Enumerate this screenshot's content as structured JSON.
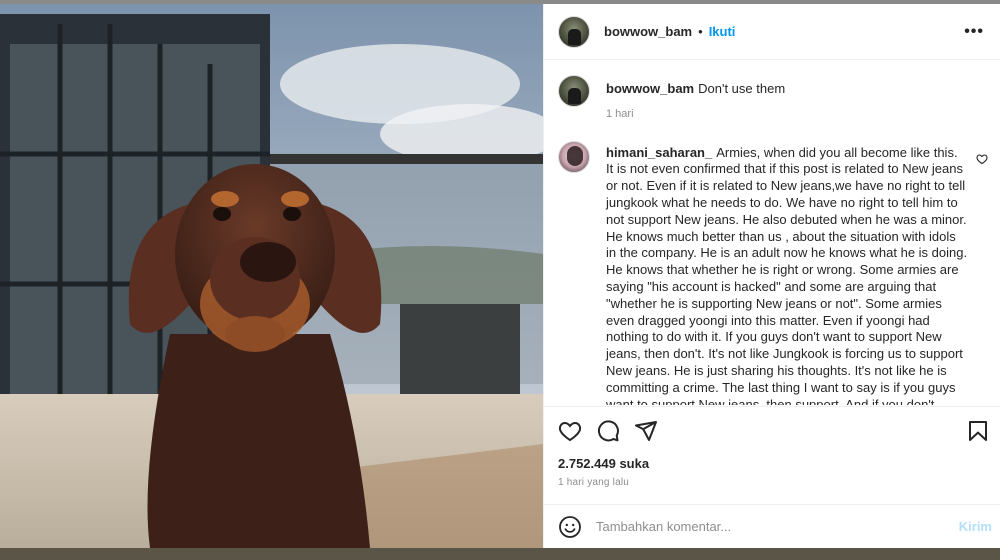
{
  "post": {
    "author": "bowwow_bam",
    "separator": "•",
    "follow_label": "Ikuti",
    "more_label": "•••",
    "caption_user": "bowwow_bam",
    "caption_text": "Don't use them",
    "caption_time": "1 hari"
  },
  "comment": {
    "user": "himani_saharan_",
    "text": "Armies, when did you all become like this. It is not even confirmed that if this post is related to New jeans or not. Even if it is related to New jeans,we have no right to tell jungkook what he needs to do. We have no right to tell him to not support New jeans. He also debuted when he was a minor. He knows much better than us , about the situation with idols in the company. He is an adult now he knows what he is doing. He knows that whether he is right or wrong. Some armies are saying \"his account is hacked\" and some are arguing that \"whether he is supporting New jeans or not\". Some armies even dragged yoongi into this matter. Even if yoongi had nothing to do with it. If you guys don't want to support New jeans, then don't. It's not like Jungkook is forcing us to support New jeans. He is just sharing his thoughts. It's not like he is committing a crime. The last thing I want to say is if you guys want to support New jeans, then support. And if you don't"
  },
  "stats": {
    "likes": "2.752.449 suka",
    "ago": "1 hari yang lalu"
  },
  "composer": {
    "placeholder": "Tambahkan komentar...",
    "post_label": "Kirim"
  },
  "icons": [
    "heart-icon",
    "comment-icon",
    "share-icon",
    "bookmark-icon",
    "emoji-icon",
    "more-icon"
  ],
  "colors": {
    "link": "#0095f6",
    "post_disabled": "#b2dffc",
    "muted": "#8e8e8e",
    "text": "#262626"
  }
}
